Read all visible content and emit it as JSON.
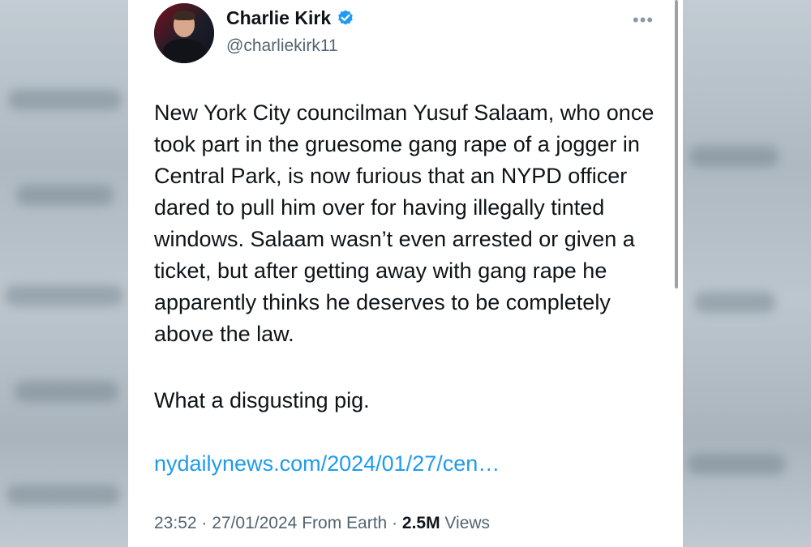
{
  "tweet": {
    "author": {
      "display_name": "Charlie Kirk",
      "handle": "@charliekirk11",
      "verified": true,
      "avatar_icon": "profile-photo"
    },
    "more_icon": "more-dots-icon",
    "text": "New York City councilman Yusuf Salaam, who once took part in the gruesome gang rape of a jogger in Central Park, is now furious that an NYPD officer dared to pull him over for having illegally tinted windows. Salaam wasn’t even arrested or given a ticket, but after getting away with gang rape he apparently thinks he deserves to be completely above the law.",
    "closing": "What a disgusting pig.",
    "link": "nydailynews.com/2024/01/27/cen…",
    "meta": {
      "time": "23:52",
      "date": "27/01/2024",
      "source": "From Earth",
      "views_count": "2.5M",
      "views_label": "Views"
    }
  },
  "colors": {
    "text_primary": "#0f1419",
    "text_secondary": "#536471",
    "link": "#1d9bf0",
    "verified_badge": "#1d9bf0"
  }
}
